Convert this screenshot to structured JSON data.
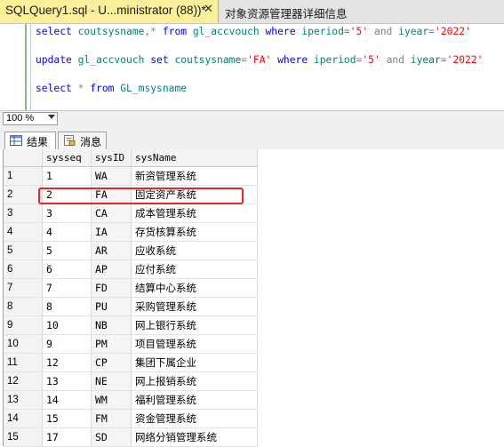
{
  "tabs": {
    "active_label": "SQLQuery1.sql - U...ministrator (88))*",
    "close_glyph": "✕",
    "inactive_label": "对象资源管理器详细信息"
  },
  "editor": {
    "lines": [
      {
        "parts": [
          {
            "t": "select ",
            "c": "kw"
          },
          {
            "t": "coutsysname",
            "c": "id"
          },
          {
            "t": ",* ",
            "c": "op"
          },
          {
            "t": "from ",
            "c": "kw"
          },
          {
            "t": "gl_accvouch ",
            "c": "id"
          },
          {
            "t": "where ",
            "c": "kw"
          },
          {
            "t": "iperiod",
            "c": "id"
          },
          {
            "t": "=",
            "c": "op"
          },
          {
            "t": "'5' ",
            "c": "str"
          },
          {
            "t": "and ",
            "c": "op"
          },
          {
            "t": "iyear",
            "c": "id"
          },
          {
            "t": "=",
            "c": "op"
          },
          {
            "t": "'2022'",
            "c": "str"
          }
        ]
      },
      {
        "parts": [
          {
            "t": "update ",
            "c": "kw"
          },
          {
            "t": "gl_accvouch ",
            "c": "id"
          },
          {
            "t": "set ",
            "c": "kw"
          },
          {
            "t": "coutsysname",
            "c": "id"
          },
          {
            "t": "=",
            "c": "op"
          },
          {
            "t": "'FA' ",
            "c": "str"
          },
          {
            "t": "where ",
            "c": "kw"
          },
          {
            "t": "iperiod",
            "c": "id"
          },
          {
            "t": "=",
            "c": "op"
          },
          {
            "t": "'5' ",
            "c": "str"
          },
          {
            "t": "and ",
            "c": "op"
          },
          {
            "t": "iyear",
            "c": "id"
          },
          {
            "t": "=",
            "c": "op"
          },
          {
            "t": "'2022'",
            "c": "str"
          }
        ]
      },
      {
        "parts": [
          {
            "t": "select ",
            "c": "kw"
          },
          {
            "t": "* ",
            "c": "op"
          },
          {
            "t": "from ",
            "c": "kw"
          },
          {
            "t": "GL_msysname",
            "c": "id"
          }
        ]
      }
    ]
  },
  "zoom": {
    "value": "100 %"
  },
  "result_tabs": [
    {
      "label": "结果",
      "icon": "grid-icon"
    },
    {
      "label": "消息",
      "icon": "message-icon"
    }
  ],
  "grid": {
    "columns": [
      "",
      "sysseq",
      "sysID",
      "sysName"
    ],
    "rows": [
      [
        "1",
        "1",
        "WA",
        "新资管理系统"
      ],
      [
        "2",
        "2",
        "FA",
        "固定资产系统"
      ],
      [
        "3",
        "3",
        "CA",
        "成本管理系统"
      ],
      [
        "4",
        "4",
        "IA",
        "存货核算系统"
      ],
      [
        "5",
        "5",
        "AR",
        "应收系统"
      ],
      [
        "6",
        "6",
        "AP",
        "应付系统"
      ],
      [
        "7",
        "7",
        "FD",
        "结算中心系统"
      ],
      [
        "8",
        "8",
        "PU",
        "采购管理系统"
      ],
      [
        "9",
        "10",
        "NB",
        "网上银行系统"
      ],
      [
        "10",
        "9",
        "PM",
        "项目管理系统"
      ],
      [
        "11",
        "12",
        "CP",
        "集团下属企业"
      ],
      [
        "12",
        "13",
        "NE",
        "网上报销系统"
      ],
      [
        "13",
        "14",
        "WM",
        "福利管理系统"
      ],
      [
        "14",
        "15",
        "FM",
        "资金管理系统"
      ],
      [
        "15",
        "17",
        "SD",
        "网络分销管理系统"
      ]
    ]
  },
  "colors": {
    "tab_active_bg": "#fcef9a",
    "highlight_border": "#e8262a",
    "keyword": "#0000ff",
    "string": "#ff0000",
    "identifier": "#008080"
  }
}
